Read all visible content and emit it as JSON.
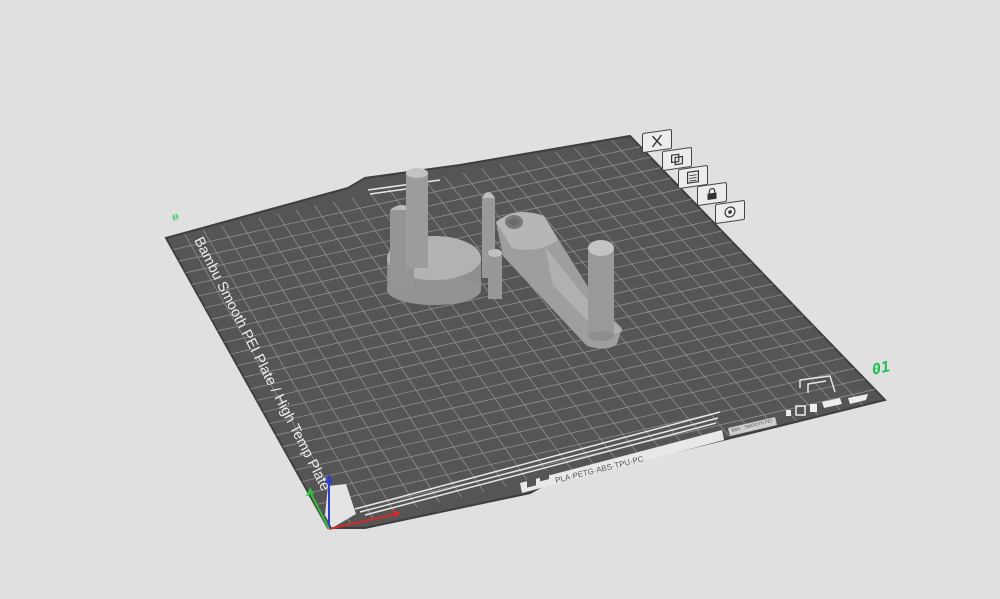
{
  "viewport": {
    "plate_number": "01",
    "plate_name_mark": "в",
    "plate": {
      "side_label": "Bambu Smooth PEI Plate / High Temp Plate",
      "filament_label": "PLA·PETG·ABS·TPU·PC",
      "filament_badges": [
        "H",
        "S"
      ],
      "small_label": "BM1 · SMOOTH PEI"
    },
    "plate_tools": [
      {
        "name": "close",
        "icon": "close-icon"
      },
      {
        "name": "arrange",
        "icon": "arrange-icon"
      },
      {
        "name": "orient",
        "icon": "orient-icon"
      },
      {
        "name": "lock",
        "icon": "lock-icon"
      },
      {
        "name": "settings",
        "icon": "settings-icon"
      }
    ],
    "axes": {
      "x_color": "#d42a2a",
      "y_color": "#2fbf3a",
      "z_color": "#2840c8"
    }
  },
  "colors": {
    "background": "#e0e0e0",
    "plate": "#555555",
    "grid": "#8a8a8a",
    "model": "#a8a8a8",
    "accent": "#1fbf56"
  }
}
